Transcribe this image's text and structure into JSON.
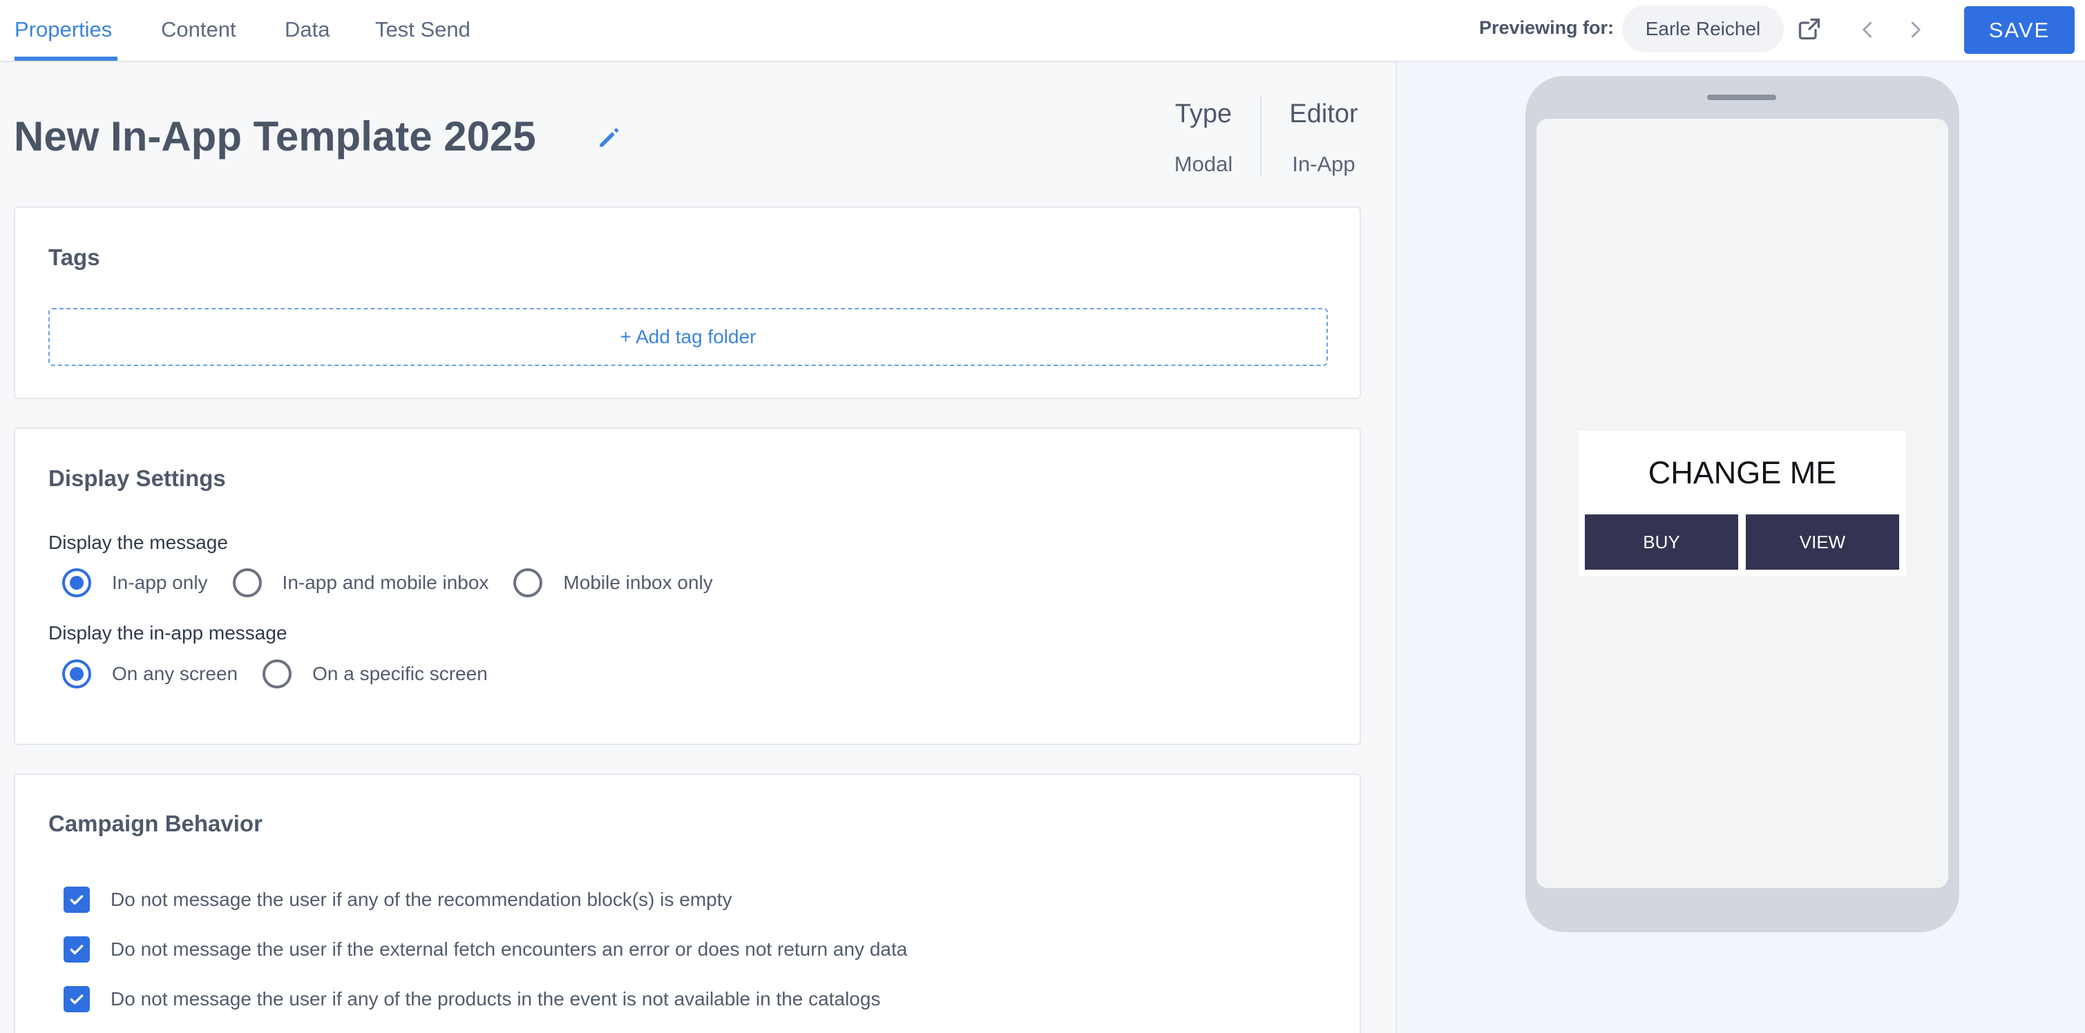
{
  "tabs": [
    {
      "label": "Properties",
      "active": true
    },
    {
      "label": "Content",
      "active": false
    },
    {
      "label": "Data",
      "active": false
    },
    {
      "label": "Test Send",
      "active": false
    }
  ],
  "header": {
    "previewing_label": "Previewing for:",
    "preview_user": "Earle Reichel",
    "save_label": "SAVE",
    "icons": [
      "external-link-icon",
      "chevron-left-icon",
      "chevron-right-icon"
    ]
  },
  "template": {
    "title": "New In-App Template 2025",
    "type_label": "Type",
    "type_value": "Modal",
    "editor_label": "Editor",
    "editor_value": "In-App"
  },
  "tags": {
    "title": "Tags",
    "add_label": "+ Add tag folder"
  },
  "display_settings": {
    "title": "Display Settings",
    "message_group_label": "Display the message",
    "message_options": [
      {
        "label": "In-app only",
        "checked": true
      },
      {
        "label": "In-app and mobile inbox",
        "checked": false
      },
      {
        "label": "Mobile inbox only",
        "checked": false
      }
    ],
    "inapp_group_label": "Display the in-app message",
    "inapp_options": [
      {
        "label": "On any screen",
        "checked": true
      },
      {
        "label": "On a specific screen",
        "checked": false
      }
    ]
  },
  "campaign_behavior": {
    "title": "Campaign Behavior",
    "checks": [
      {
        "label": "Do not message the user if any of the recommendation block(s) is empty",
        "checked": true
      },
      {
        "label": "Do not message the user if the external fetch encounters an error or does not return any data",
        "checked": true
      },
      {
        "label": "Do not message the user if any of the products in the event is not available in the catalogs",
        "checked": true
      }
    ]
  },
  "preview": {
    "modal_title": "CHANGE ME",
    "buy_label": "BUY",
    "view_label": "VIEW"
  },
  "colors": {
    "accent": "#2f6fe0",
    "tab_active": "#3b84dd",
    "modal_button": "#333452",
    "phone_frame": "#d2d6de"
  }
}
